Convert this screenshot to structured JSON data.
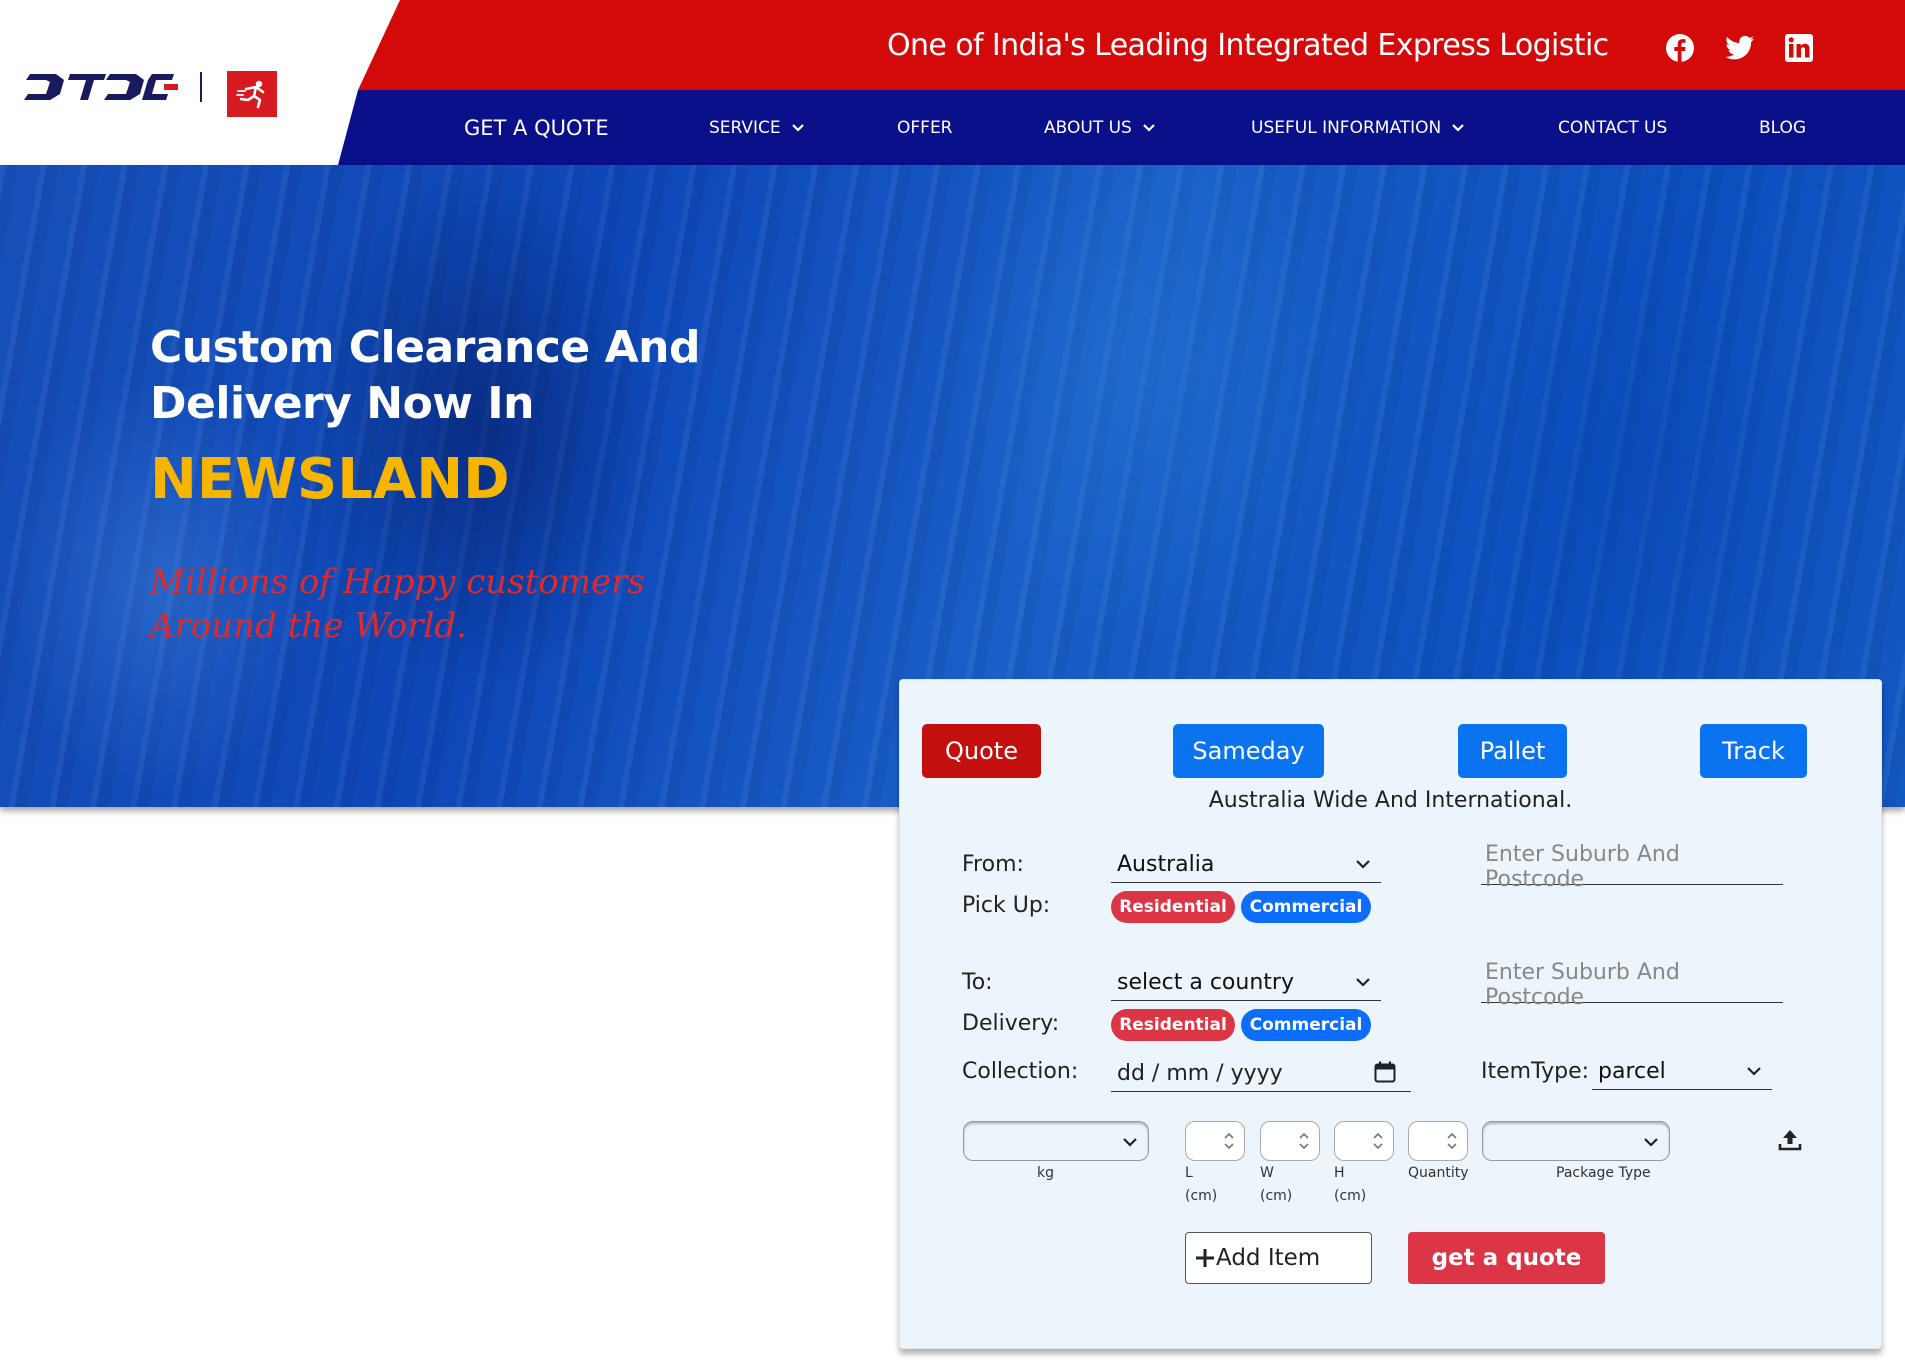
{
  "header": {
    "tagline": "One of India's Leading Integrated Express Logistics Provider",
    "logo_text": "DTDC",
    "social": [
      "facebook-icon",
      "twitter-icon",
      "linkedin-icon"
    ]
  },
  "nav": {
    "get_quote": "GET A QUOTE",
    "service": "SERVICE",
    "offer": "OFFER",
    "about_us": "ABOUT US",
    "useful_information": "USEFUL INFORMATION",
    "contact_us": "CONTACT US",
    "blog": "BLOG"
  },
  "hero": {
    "line1": "Custom Clearance And",
    "line2": "Delivery Now In",
    "highlight": "NEWSLAND",
    "sub_line1": "Millions of Happy customers",
    "sub_line2": "Around the World."
  },
  "quote_panel": {
    "tabs": [
      "Quote",
      "Sameday",
      "Pallet",
      "Track"
    ],
    "caption": "Australia Wide And International.",
    "from_label": "From:",
    "from_value": "Australia",
    "from_postcode_placeholder": "Enter Suburb And Postcode",
    "pickup_label": "Pick Up:",
    "to_label": "To:",
    "to_value": "select a country",
    "to_postcode_placeholder": "Enter Suburb And Postcode",
    "delivery_label": "Delivery:",
    "residential": "Residential",
    "commercial": "Commercial",
    "collection_label": "Collection:",
    "collection_placeholder": "dd / mm / yyyy",
    "itemtype_label": "ItemType:",
    "itemtype_value": "parcel",
    "kg_label": "kg",
    "l_label": "L",
    "w_label": "W",
    "h_label": "H",
    "cm_label": "(cm)",
    "quantity_label": "Quantity",
    "package_type_label": "Package Type",
    "add_item": "Add Item",
    "get_quote": "get a quote"
  },
  "colors": {
    "topbar_red": "#d40a0a",
    "nav_blue": "#0a0f8a",
    "accent_yellow": "#f7b500",
    "tab_blue": "#0a74f0",
    "pill_red": "#dc3545",
    "pill_blue": "#0d6efd"
  }
}
